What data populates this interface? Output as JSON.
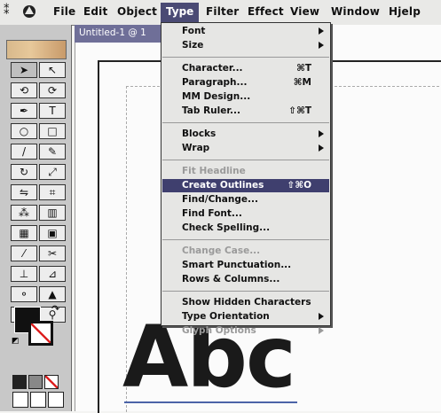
{
  "menubar": {
    "items": [
      "File",
      "Edit",
      "Object",
      "Type",
      "Filter",
      "Effect",
      "View",
      "Window",
      "Hjelp"
    ],
    "active": "Type"
  },
  "document": {
    "title": "Untitled-1 @ 1",
    "canvas_text": "Abc"
  },
  "type_menu": {
    "items": [
      {
        "label": "Font",
        "shortcut": "",
        "submenu": true,
        "enabled": true
      },
      {
        "label": "Size",
        "shortcut": "",
        "submenu": true,
        "enabled": true
      },
      {
        "label": "Character...",
        "shortcut": "⌘T",
        "submenu": false,
        "enabled": true
      },
      {
        "label": "Paragraph...",
        "shortcut": "⌘M",
        "submenu": false,
        "enabled": true
      },
      {
        "label": "MM Design...",
        "shortcut": "",
        "submenu": false,
        "enabled": true
      },
      {
        "label": "Tab Ruler...",
        "shortcut": "⇧⌘T",
        "submenu": false,
        "enabled": true
      },
      {
        "label": "Blocks",
        "shortcut": "",
        "submenu": true,
        "enabled": true
      },
      {
        "label": "Wrap",
        "shortcut": "",
        "submenu": true,
        "enabled": true
      },
      {
        "label": "Fit Headline",
        "shortcut": "",
        "submenu": false,
        "enabled": false
      },
      {
        "label": "Create Outlines",
        "shortcut": "⇧⌘O",
        "submenu": false,
        "enabled": true,
        "highlighted": true
      },
      {
        "label": "Find/Change...",
        "shortcut": "",
        "submenu": false,
        "enabled": true
      },
      {
        "label": "Find Font...",
        "shortcut": "",
        "submenu": false,
        "enabled": true
      },
      {
        "label": "Check Spelling...",
        "shortcut": "",
        "submenu": false,
        "enabled": true
      },
      {
        "label": "Change Case...",
        "shortcut": "",
        "submenu": false,
        "enabled": false
      },
      {
        "label": "Smart Punctuation...",
        "shortcut": "",
        "submenu": false,
        "enabled": true
      },
      {
        "label": "Rows & Columns...",
        "shortcut": "",
        "submenu": false,
        "enabled": true
      },
      {
        "label": "Show Hidden Characters",
        "shortcut": "",
        "submenu": false,
        "enabled": true
      },
      {
        "label": "Type Orientation",
        "shortcut": "",
        "submenu": true,
        "enabled": true
      },
      {
        "label": "Glyph Options",
        "shortcut": "",
        "submenu": true,
        "enabled": false
      }
    ]
  },
  "toolbox": {
    "tools": [
      {
        "name": "selection-tool",
        "glyph": "➤"
      },
      {
        "name": "direct-selection-tool",
        "glyph": "↖"
      },
      {
        "name": "lasso-tool",
        "glyph": "⟲"
      },
      {
        "name": "direct-select-lasso-tool",
        "glyph": "⟳"
      },
      {
        "name": "pen-tool",
        "glyph": "✒"
      },
      {
        "name": "type-tool",
        "glyph": "T"
      },
      {
        "name": "ellipse-tool",
        "glyph": "○"
      },
      {
        "name": "rectangle-tool",
        "glyph": "□"
      },
      {
        "name": "paintbrush-tool",
        "glyph": "/"
      },
      {
        "name": "pencil-tool",
        "glyph": "✎"
      },
      {
        "name": "rotate-tool",
        "glyph": "↻"
      },
      {
        "name": "scale-tool",
        "glyph": "⤢"
      },
      {
        "name": "reflect-tool",
        "glyph": "⇋"
      },
      {
        "name": "free-transform-tool",
        "glyph": "⌗"
      },
      {
        "name": "symbol-sprayer-tool",
        "glyph": "⁂"
      },
      {
        "name": "column-graph-tool",
        "glyph": "▥"
      },
      {
        "name": "mesh-tool",
        "glyph": "▦"
      },
      {
        "name": "gradient-tool",
        "glyph": "▣"
      },
      {
        "name": "eyedropper-tool",
        "glyph": "⁄"
      },
      {
        "name": "scissors-tool",
        "glyph": "✂"
      },
      {
        "name": "measure-tool",
        "glyph": "⊥"
      },
      {
        "name": "slice-tool",
        "glyph": "⊿"
      },
      {
        "name": "blend-tool",
        "glyph": "⚬"
      },
      {
        "name": "warp-tool",
        "glyph": "▲"
      },
      {
        "name": "hand-tool",
        "glyph": "✋"
      },
      {
        "name": "zoom-tool",
        "glyph": "⚲"
      }
    ]
  },
  "colors": {
    "menu_highlight": "#3f3f6e",
    "titlebar": "#6f6f98",
    "fill_swatch": "#111111",
    "stroke_none": "#dd2222"
  }
}
